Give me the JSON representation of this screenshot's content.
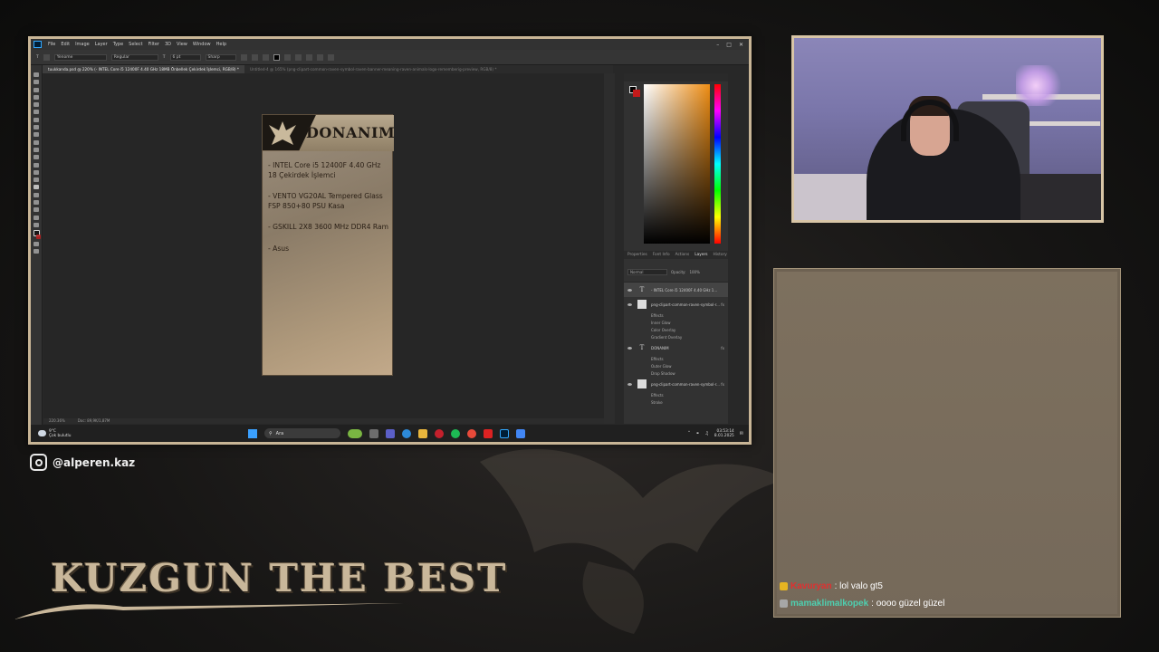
{
  "photoshop": {
    "menu": [
      "File",
      "Edit",
      "Image",
      "Layer",
      "Type",
      "Select",
      "Filter",
      "3D",
      "View",
      "Window",
      "Help"
    ],
    "options": {
      "font_family": "Yenome",
      "font_style": "Regular",
      "font_size": "6 pt",
      "anti_alias": "Sharp"
    },
    "tabs": [
      {
        "label": "tuukkanda.psd @ 220% (- INTEL Core i5 12400F 4.40 GHz 18MB Önbellek Çekirdek İşlemci, RGB/8) *",
        "active": true
      },
      {
        "label": "Untitled-4 @ 165% (png-clipart-common-raven-symbol-raven-banner-meaning-raven-animals-logo-rememberig-preview, RGB/8) *",
        "active": false
      }
    ],
    "artboard": {
      "title": "DONANIM",
      "lines": [
        "- INTEL Core i5 12400F 4.40 GHz 18 Çekirdek İşlemci",
        "- VENTO VG20AL Tempered Glass FSP 850+80 PSU Kasa",
        "- GSKILL 2X8 3600 MHz DDR4 Ram",
        "- Asus"
      ]
    },
    "status": {
      "zoom": "220.36%",
      "doc": "Doc: 89,9K/1,87M"
    },
    "panel_tabs": [
      "Properties",
      "Font Info",
      "Actions",
      "Layers",
      "History"
    ],
    "color_label": "Color",
    "layers_controls": {
      "blend": "Normal",
      "opacity_label": "Opacity:",
      "opacity": "100%",
      "fill_label": "Fill:",
      "fill": "100%"
    },
    "layers": [
      {
        "kind": "text",
        "name": "- INTEL Core i5 12400F 4.40 GHz 1...",
        "selected": true,
        "fx": false,
        "effects": []
      },
      {
        "kind": "image",
        "name": "png-clipart-common-raven-symbol-r...",
        "selected": false,
        "fx": true,
        "effects": [
          "Effects",
          "Inner Glow",
          "Color Overlay",
          "Gradient Overlay"
        ]
      },
      {
        "kind": "text",
        "name": "DONANIM",
        "selected": false,
        "fx": true,
        "effects": [
          "Effects",
          "Outer Glow",
          "Drop Shadow"
        ]
      },
      {
        "kind": "image",
        "name": "png-clipart-common-raven-symbol-r...",
        "selected": false,
        "fx": true,
        "effects": [
          "Effects",
          "Stroke"
        ]
      }
    ],
    "taskbar": {
      "weather_temp": "9°C",
      "weather_desc": "Çok bulutlu",
      "search": "Ara",
      "time": "03:53:14",
      "date": "8.01.2025"
    }
  },
  "overlay": {
    "instagram": "@alperen.kaz",
    "title": "KUZGUN THE BEST"
  },
  "chat": [
    {
      "user": "Kavuryan",
      "text": ": lol valo gt5",
      "color": "#e03030"
    },
    {
      "user": "mamaklimalkopek",
      "text": ": oooo güzel güzel",
      "color": "#4ecfb0"
    }
  ],
  "colors": {
    "frame": "#c8b596",
    "picker_hue": "#ee8d14",
    "foreground": "#000000",
    "background": "#c41a1a"
  }
}
